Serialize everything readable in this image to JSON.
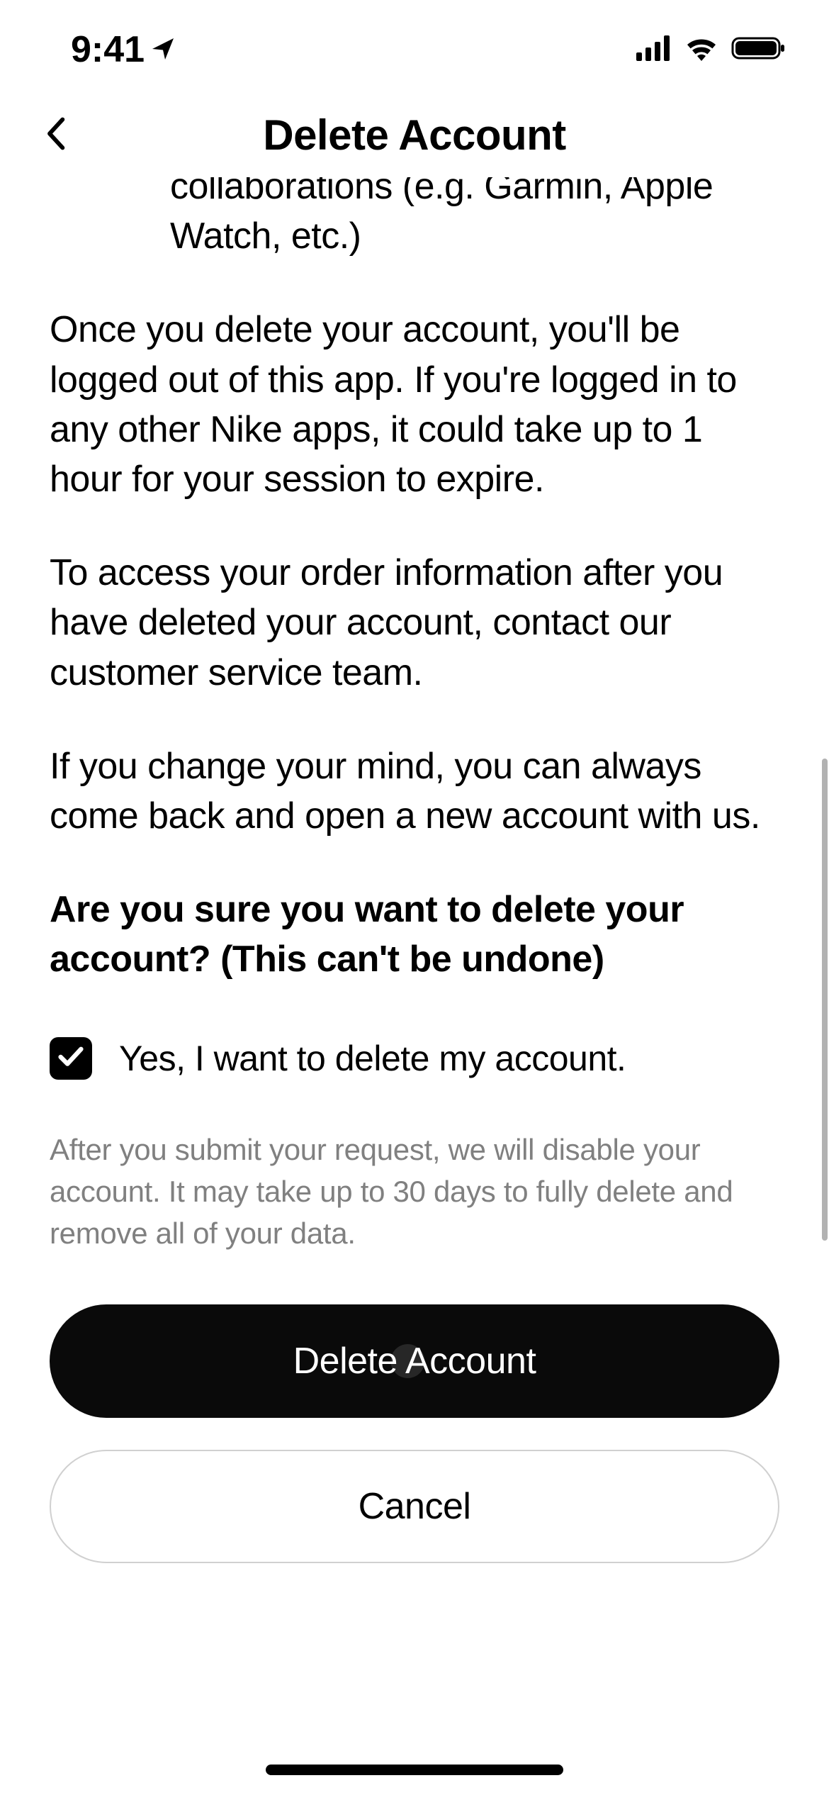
{
  "statusBar": {
    "time": "9:41"
  },
  "header": {
    "title": "Delete Account"
  },
  "content": {
    "partialLine": "collaborations (e.g. Garmin, Apple Watch, etc.)",
    "paragraph1": "Once you delete your account, you'll be logged out of this app. If you're logged in to any other Nike apps, it could take up to 1 hour for your session to expire.",
    "paragraph2": "To access your order information after you have deleted your account, contact our customer service team.",
    "paragraph3": "If you change your mind, you can always come back and open a new account with us.",
    "confirmQuestion": "Are you sure you want to delete your account? (This can't be undone)",
    "checkboxLabel": "Yes, I want to delete my account.",
    "finePrint": "After you submit your request, we will disable your account. It may take up to 30 days to fully delete and remove all of your data."
  },
  "buttons": {
    "primary": "Delete Account",
    "secondary": "Cancel"
  }
}
